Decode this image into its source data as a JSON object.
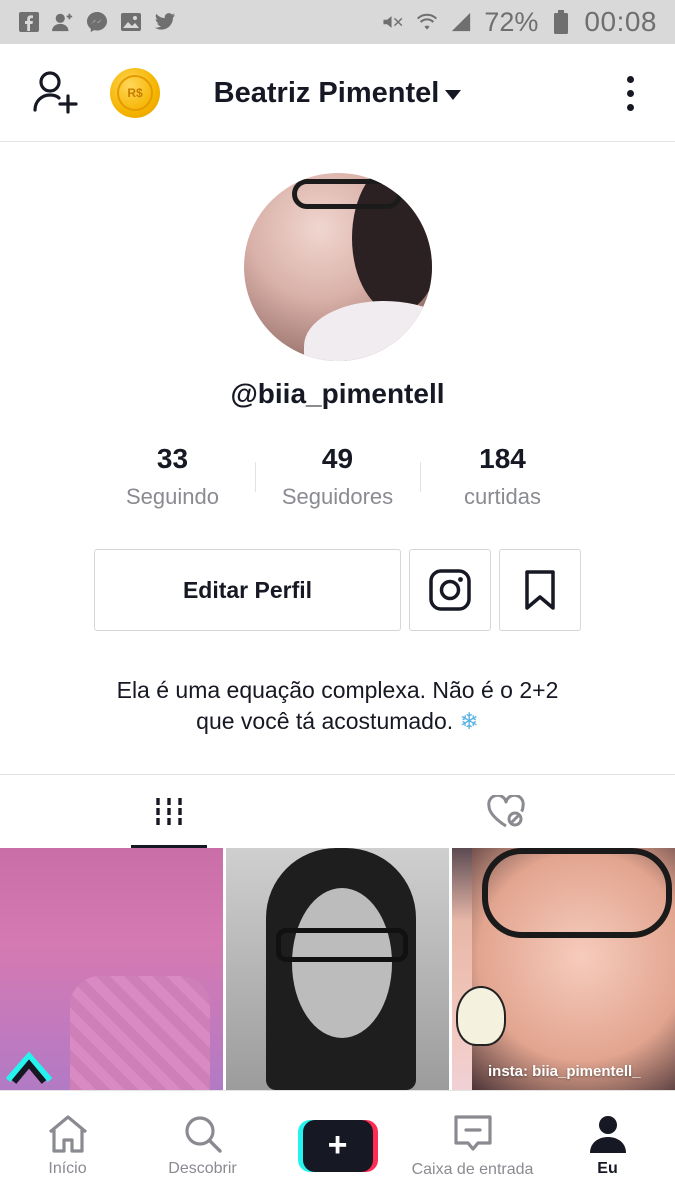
{
  "status_bar": {
    "battery": "72%",
    "time": "00:08",
    "left_icons": [
      "facebook-icon",
      "add-contact-icon",
      "messenger-icon",
      "gallery-icon",
      "twitter-icon"
    ],
    "right_icons": [
      "mute-icon",
      "wifi-icon",
      "signal-icon",
      "battery-icon"
    ]
  },
  "header": {
    "account_name": "Beatriz Pimentel",
    "coin_label": "R$"
  },
  "profile": {
    "username": "@biia_pimentell",
    "stats": [
      {
        "value": "33",
        "label": "Seguindo"
      },
      {
        "value": "49",
        "label": "Seguidores"
      },
      {
        "value": "184",
        "label": "curtidas"
      }
    ],
    "edit_button": "Editar Perfil",
    "bio_line1": "Ela é uma equação complexa. Não é o 2+2",
    "bio_line2": "que você tá acostumado.",
    "bio_emoji": "❄"
  },
  "grid": {
    "caption_3": "insta: biia_pimentell_"
  },
  "nav": {
    "home": "Início",
    "discover": "Descobrir",
    "create": "+",
    "inbox": "Caixa de entrada",
    "me": "Eu"
  },
  "colors": {
    "text": "#161823",
    "muted": "#8a8b91",
    "border": "#e3e3e4",
    "accent_cyan": "#25f4ee",
    "accent_red": "#fe2c55",
    "coin": "#f5b400"
  }
}
